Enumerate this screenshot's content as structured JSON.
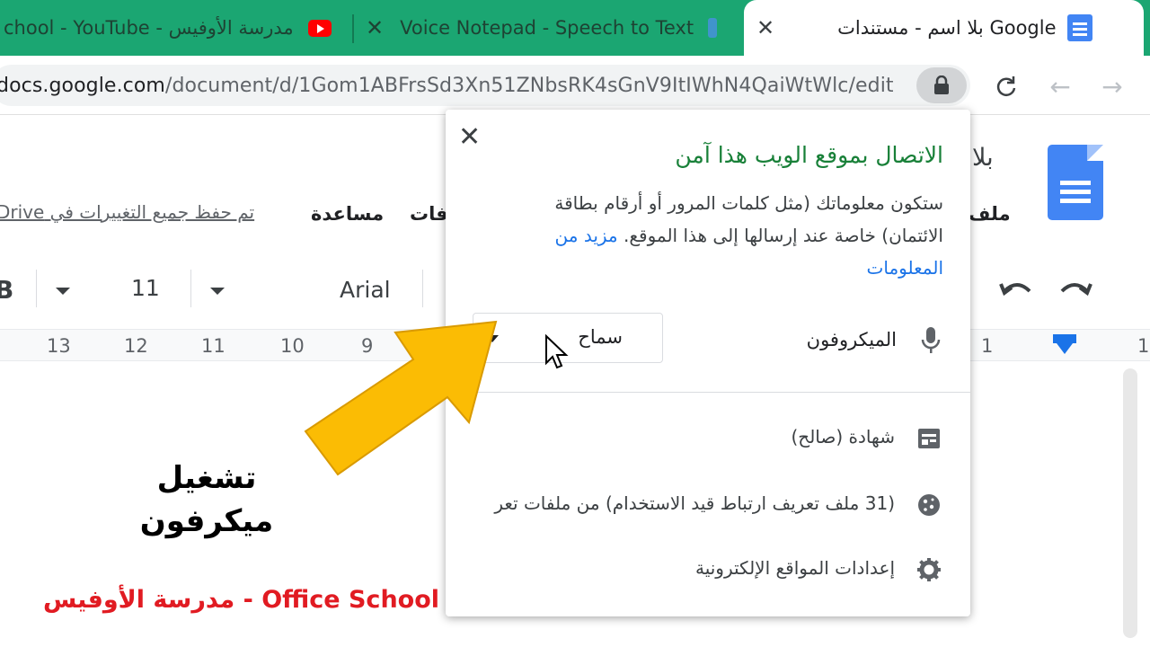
{
  "tabs": [
    {
      "title": "chool - YouTube - مدرسة الأوفيس",
      "icon": "youtube-icon"
    },
    {
      "title": "Voice Notepad - Speech to Text",
      "icon": "voice-notepad-icon"
    },
    {
      "title": "بلا اسم - مستندات Google",
      "icon": "google-docs-icon",
      "active": true
    }
  ],
  "address_bar": {
    "url": "docs.google.com/document/d/1Gom1ABFrsSd3Xn51ZNbsRK4sGnV9ItIWhN4QaiWtWlc/edit",
    "url_host": "docs.google.com",
    "url_path": "/document/d/1Gom1ABFrsSd3Xn51ZNbsRK4sGnV9ItIWhN4QaiWtWlc/edit",
    "lock_icon": "lock-icon"
  },
  "docs": {
    "title": "بلا",
    "menu": [
      "ملف",
      "فات",
      "مساعدة"
    ],
    "saved_status": "تم حفظ جميع التغييرات في Drive",
    "toolbar": {
      "font": "Arial",
      "size": "11",
      "bold": "B"
    },
    "ruler": [
      "13",
      "12",
      "11",
      "10",
      "9",
      "1",
      "1"
    ]
  },
  "site_info_popup": {
    "title": "الاتصال بموقع الويب هذا آمن",
    "description": "ستكون معلوماتك (مثل كلمات المرور أو أرقام بطاقة الائتمان) خاصة عند إرسالها إلى هذا الموقع.",
    "learn_more": "مزيد من المعلومات",
    "permission": {
      "label": "الميكروفون",
      "value": "سماح",
      "icon": "microphone-icon"
    },
    "rows": [
      {
        "label": "شهادة (صالح)",
        "icon": "certificate-icon"
      },
      {
        "label": "(31 ملف تعريف ارتباط قيد الاستخدام) من ملفات تعر",
        "icon": "cookie-icon"
      },
      {
        "label": "إعدادات المواقع الإلكترونية",
        "icon": "gear-icon"
      }
    ]
  },
  "overlay": {
    "caption_line1": "تشغيل",
    "caption_line2": "ميكرفون",
    "watermark": "مدرسة الأوفيس - Office School",
    "arrow_color": "#fbbc04"
  }
}
